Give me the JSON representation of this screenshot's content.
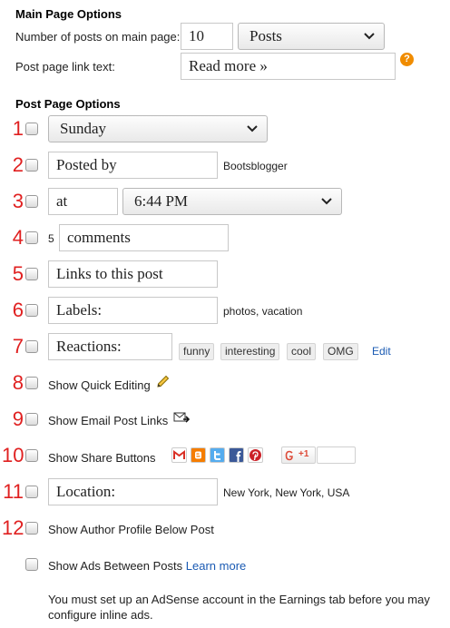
{
  "main_options": {
    "heading": "Main Page Options",
    "posts_label": "Number of posts on main page:",
    "posts_count": "10",
    "posts_unit": "Posts",
    "link_label": "Post page link text:",
    "link_text": "Read more »",
    "help_glyph": "?"
  },
  "post_options": {
    "heading": "Post Page Options",
    "rows": [
      {
        "num": "1",
        "value": "Sunday"
      },
      {
        "num": "2",
        "value": "Posted by",
        "after": "Bootsblogger"
      },
      {
        "num": "3",
        "value": "at",
        "time": "6:44 PM"
      },
      {
        "num": "4",
        "count": "5",
        "value": "comments"
      },
      {
        "num": "5",
        "value": "Links to this post"
      },
      {
        "num": "6",
        "value": "Labels:",
        "after": "photos, vacation"
      },
      {
        "num": "7",
        "value": "Reactions:",
        "tags": [
          "funny",
          "interesting",
          "cool",
          "OMG"
        ],
        "edit": "Edit"
      },
      {
        "num": "8",
        "label": "Show Quick Editing"
      },
      {
        "num": "9",
        "label": "Show Email Post Links"
      },
      {
        "num": "10",
        "label": "Show Share Buttons",
        "gplus": "+1"
      },
      {
        "num": "11",
        "value": "Location:",
        "after": "New York, New York, USA"
      },
      {
        "num": "12",
        "label": "Show Author Profile Below Post"
      }
    ],
    "ads_label": "Show Ads Between Posts",
    "ads_link": "Learn more",
    "ads_note_line1": "You must set up an AdSense account in the Earnings tab before you may",
    "ads_note_line2": "configure inline ads."
  },
  "icons": {
    "chevron": "chevron-down-icon",
    "help": "help-icon",
    "pencil": "pencil-icon",
    "email": "email-post-icon",
    "share": [
      "gmail-icon",
      "blogger-icon",
      "twitter-icon",
      "facebook-icon",
      "pinterest-icon",
      "google-plus-icon"
    ]
  },
  "colors": {
    "step_numbers": "#e02020",
    "link": "#1a5ab3",
    "help_icon": "#f08c00",
    "gmail": "#d93025",
    "blogger": "#f57d00",
    "twitter": "#55acee",
    "facebook": "#3b5998",
    "pinterest": "#cb2027",
    "google_plus": "#dd4b39"
  }
}
